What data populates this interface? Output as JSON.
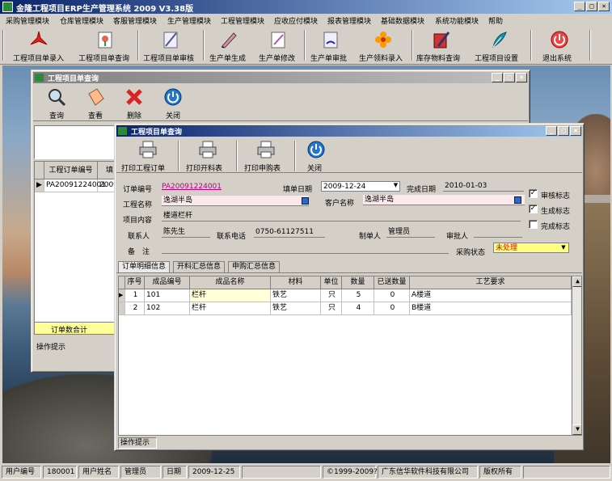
{
  "app": {
    "title": "金隆工程项目ERP生产管理系统 2009 V3.38版"
  },
  "menu": [
    "采购管理模块",
    "仓库管理模块",
    "客服管理模块",
    "生产管理模块",
    "工程管理模块",
    "应收应付模块",
    "报表管理模块",
    "基础数据模块",
    "系统功能模块",
    "帮助"
  ],
  "toolbar": [
    "工程项目单录入",
    "工程项目单查询",
    "工程项目单审核",
    "生产单生成",
    "生产单修改",
    "生产单审批",
    "生产领料录入",
    "库存物料查询",
    "工程项目设置",
    "退出系统"
  ],
  "win1": {
    "title": "工程项目单查询",
    "buttons": [
      "查询",
      "查看",
      "删除",
      "关闭"
    ],
    "columns": [
      "工程订单编号",
      "填"
    ],
    "row": [
      "PA20091224001",
      "2009"
    ],
    "total_label": "订单数合计",
    "hint": "操作提示"
  },
  "win2": {
    "title": "工程项目单查询",
    "buttons": [
      "打印工程订单",
      "打印开料表",
      "打印申购表",
      "关闭"
    ],
    "labels": {
      "order_no": "订单编号",
      "fill_date": "填单日期",
      "finish_date": "完成日期",
      "project_name": "工程名称",
      "customer": "客户名称",
      "content": "项目内容",
      "contact": "联系人",
      "phone": "联系电话",
      "maker": "制单人",
      "approver": "审批人",
      "remark": "备　注",
      "purchase_status": "采购状态"
    },
    "values": {
      "order_no": "PA20091224001",
      "fill_date": "2009-12-24",
      "finish_date": "2010-01-03",
      "project_name": "逸湖半岛",
      "customer": "逸湖半岛",
      "content": "楼道栏杆",
      "contact": "陈先生",
      "phone": "0750-61127511",
      "maker": "管理员",
      "approver": "",
      "remark": "",
      "purchase_status": "未处理"
    },
    "checks": [
      {
        "label": "审核标志",
        "checked": true
      },
      {
        "label": "生成标志",
        "checked": true
      },
      {
        "label": "完成标志",
        "checked": false
      }
    ],
    "tabs": [
      "订单明细信息",
      "开料汇总信息",
      "申购汇总信息"
    ],
    "columns": [
      "序号",
      "成品编号",
      "成品名称",
      "材料",
      "单位",
      "数量",
      "已送数量",
      "工艺要求"
    ],
    "rows": [
      [
        "1",
        "101",
        "栏杆",
        "铁艺",
        "只",
        "5",
        "0",
        "A楼道"
      ],
      [
        "2",
        "102",
        "栏杆",
        "铁艺",
        "只",
        "4",
        "0",
        "B楼道"
      ]
    ],
    "hint": "操作提示"
  },
  "status": {
    "user_id_label": "用户编号",
    "user_id": "180001",
    "user_name_label": "用户姓名",
    "user_name": "管理员",
    "date_label": "日期",
    "date": "2009-12-25",
    "copyright": "©1999-2009?",
    "company": "广东信华软件科技有限公司",
    "rights": "版权所有"
  },
  "colors": {
    "title_active": "#0a246a",
    "title_inactive": "#808080",
    "highlight_row": "#ffff99",
    "status_value": "#ff0000"
  }
}
